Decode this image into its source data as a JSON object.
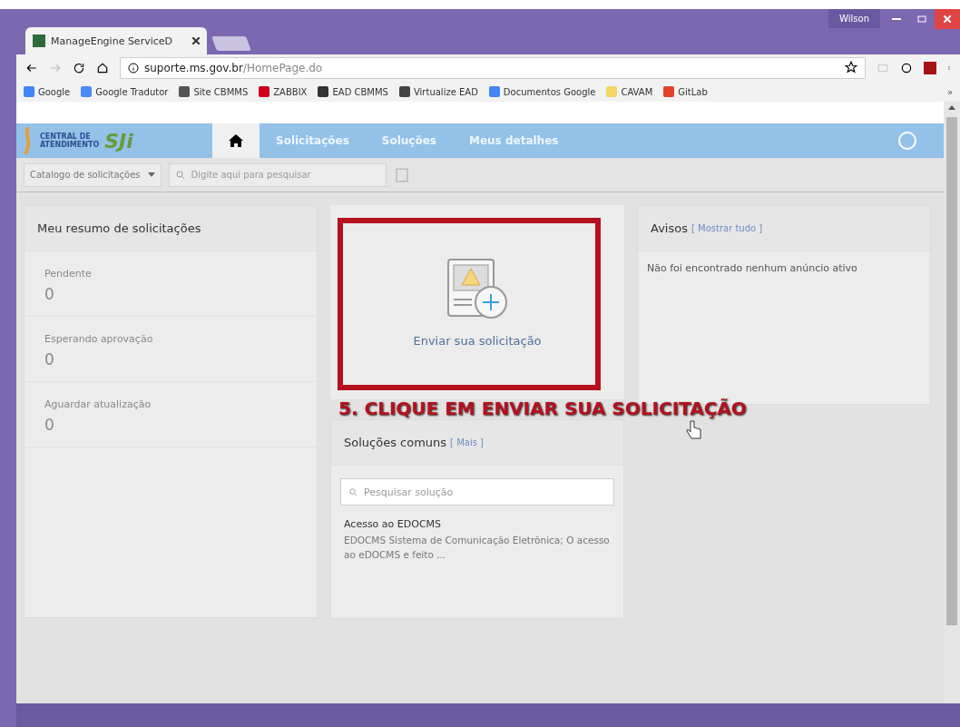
{
  "browser": {
    "tab_title": "ManageEngine ServiceD",
    "user": "Wilson",
    "url_host": "suporte.ms.gov.br",
    "url_path": "/HomePage.do",
    "bookmarks": [
      {
        "label": "Google",
        "color": "#4285f4"
      },
      {
        "label": "Google Tradutor",
        "color": "#4a8af4"
      },
      {
        "label": "Site CBMMS",
        "color": "#555555"
      },
      {
        "label": "ZABBIX",
        "color": "#d0021b"
      },
      {
        "label": "EAD CBMMS",
        "color": "#333333"
      },
      {
        "label": "Virtualize EAD",
        "color": "#444444"
      },
      {
        "label": "Documentos Google",
        "color": "#4285f4"
      },
      {
        "label": "CAVAM",
        "color": "#f5d66b"
      },
      {
        "label": "GitLab",
        "color": "#e24329"
      }
    ],
    "more": "»"
  },
  "app": {
    "logo": {
      "line1": "CENTRAL DE",
      "line2": "ATENDIMENTO",
      "mark": "SJi"
    },
    "nav": [
      {
        "kind": "home",
        "selected": true
      },
      {
        "kind": "link",
        "label": "Solicitações",
        "selected": false
      },
      {
        "kind": "link",
        "label": "Soluções",
        "selected": false
      },
      {
        "kind": "link",
        "label": "Meus detalhes",
        "selected": false
      }
    ],
    "catalog": "Catalogo de solicitações",
    "search_placeholder": "Digite aqui para pesquisar"
  },
  "summary": {
    "title": "Meu resumo de solicitações",
    "items": [
      {
        "label": "Pendente",
        "count": "0"
      },
      {
        "label": "Esperando aprovação",
        "count": "0"
      },
      {
        "label": "Aguardar atualização",
        "count": "0"
      }
    ]
  },
  "request_card": {
    "label": "Enviar sua solicitação"
  },
  "solutions": {
    "title": "Soluções comuns",
    "link": "[ Mais ]",
    "search_placeholder": "Pesquisar solução",
    "items": [
      {
        "title": "Acesso ao EDOCMS",
        "description": "EDOCMS Sistema de Comunicação Eletrônica; O acesso ao eDOCMS e feito ..."
      }
    ]
  },
  "notices": {
    "title": "Avisos",
    "link": "[ Mostrar tudo ]",
    "message": "Não foi encontrado nenhum anúncio ativo"
  },
  "annotation": {
    "caption": "5. CLIQUE EM ENVIAR SUA SOLICITAÇÃO"
  }
}
